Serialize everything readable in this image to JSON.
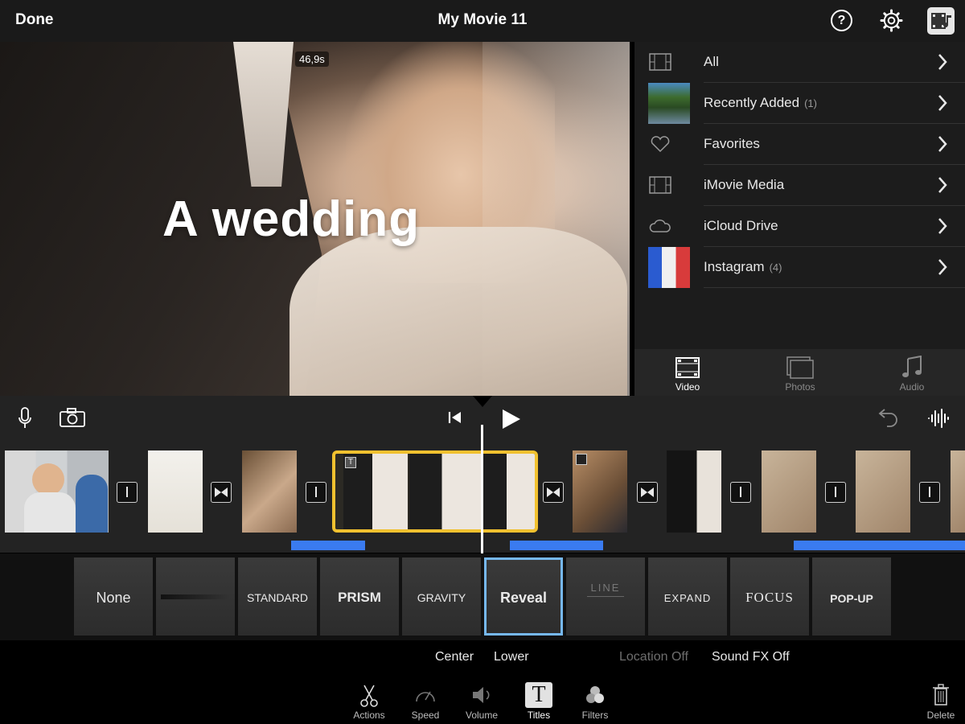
{
  "header": {
    "done_label": "Done",
    "title": "My Movie 11",
    "help_icon": "help-icon",
    "settings_icon": "gear-icon",
    "media_icon": "media-browser-icon"
  },
  "viewer": {
    "timestamp": "46,9s",
    "overlay_title": "A wedding"
  },
  "browser": {
    "items": [
      {
        "label": "All",
        "count": "",
        "icon": "film-icon"
      },
      {
        "label": "Recently Added",
        "count": "(1)",
        "icon": "thumbnail"
      },
      {
        "label": "Favorites",
        "count": "",
        "icon": "heart-icon"
      },
      {
        "label": "iMovie Media",
        "count": "",
        "icon": "film-icon"
      },
      {
        "label": "iCloud Drive",
        "count": "",
        "icon": "cloud-icon"
      },
      {
        "label": "Instagram",
        "count": "(4)",
        "icon": "thumbnail"
      }
    ],
    "tabs": [
      {
        "label": "Video",
        "active": true
      },
      {
        "label": "Photos",
        "active": false
      },
      {
        "label": "Audio",
        "active": false
      }
    ]
  },
  "title_styles": {
    "items": [
      "None",
      "",
      "STANDARD",
      "PRISM",
      "GRAVITY",
      "Reveal",
      "LINE",
      "EXPAND",
      "FOCUS",
      "POP-UP"
    ],
    "selected": "Reveal"
  },
  "options": {
    "center": "Center",
    "lower": "Lower",
    "location": "Location Off",
    "sound_fx": "Sound FX Off"
  },
  "toolbar": {
    "actions": "Actions",
    "speed": "Speed",
    "volume": "Volume",
    "titles": "Titles",
    "filters": "Filters",
    "delete": "Delete"
  },
  "colors": {
    "selection": "#f1c12f",
    "audio": "#3a7bf0",
    "selected_style": "#76b8f0"
  }
}
